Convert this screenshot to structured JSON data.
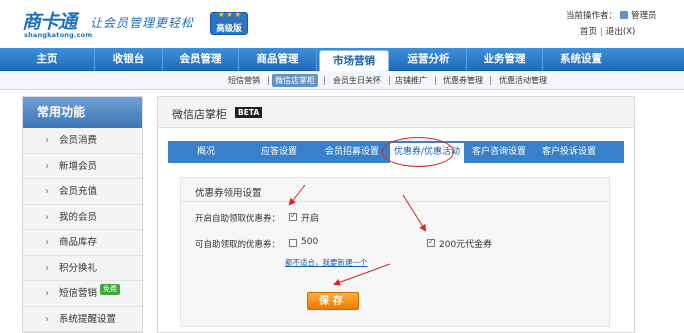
{
  "brand": {
    "logo_text": "商卡通",
    "logo_domain": "shangkatong.com",
    "slogan": "让会员管理更轻松",
    "edition_stars": "★★★",
    "edition": "高级版"
  },
  "header": {
    "operator_label": "当前操作者：",
    "operator_name": "管理员",
    "home_link": "首页",
    "logout_link": "退出(X)"
  },
  "main_nav": [
    {
      "label": "主页"
    },
    {
      "label": "收银台"
    },
    {
      "label": "会员管理"
    },
    {
      "label": "商品管理"
    },
    {
      "label": "市场营销"
    },
    {
      "label": "运营分析"
    },
    {
      "label": "业务管理"
    },
    {
      "label": "系统设置"
    }
  ],
  "sub_nav": [
    {
      "label": "短信营销"
    },
    {
      "label": "微信店掌柜"
    },
    {
      "label": "会员生日关怀"
    },
    {
      "label": "店铺推广"
    },
    {
      "label": "优惠券管理"
    },
    {
      "label": "优惠活动管理"
    }
  ],
  "sidebar": {
    "title": "常用功能",
    "chevron": "›",
    "items": [
      {
        "label": "会员消费"
      },
      {
        "label": "新增会员"
      },
      {
        "label": "会员充值"
      },
      {
        "label": "我的会员"
      },
      {
        "label": "商品库存"
      },
      {
        "label": "积分换礼"
      },
      {
        "label": "短信营销",
        "badge": "免费"
      },
      {
        "label": "系统提醒设置"
      }
    ]
  },
  "panel": {
    "title": "微信店掌柜",
    "beta": "BETA",
    "tabs": [
      {
        "label": "概况"
      },
      {
        "label": "应答设置"
      },
      {
        "label": "会员招募设置"
      },
      {
        "label": "优惠券/优惠活动"
      },
      {
        "label": "客户咨询设置"
      },
      {
        "label": "客户投诉设置"
      }
    ],
    "form": {
      "section_title": "优惠券领用设置",
      "auto_receive_label": "开启自助领取优惠券：",
      "auto_receive_option": "开启",
      "auto_receive_checked": true,
      "coupons_label": "可自助领取的优惠券：",
      "coupon_options": [
        {
          "label": "500",
          "checked": false
        },
        {
          "label": "200元代金券",
          "checked": true
        }
      ],
      "create_link": "都不适合，我要新建一个",
      "save_button": "保存"
    }
  },
  "colors": {
    "nav_blue": "#2a78c8",
    "annotation_red": "#d9261c",
    "save_orange": "#f08a10"
  }
}
